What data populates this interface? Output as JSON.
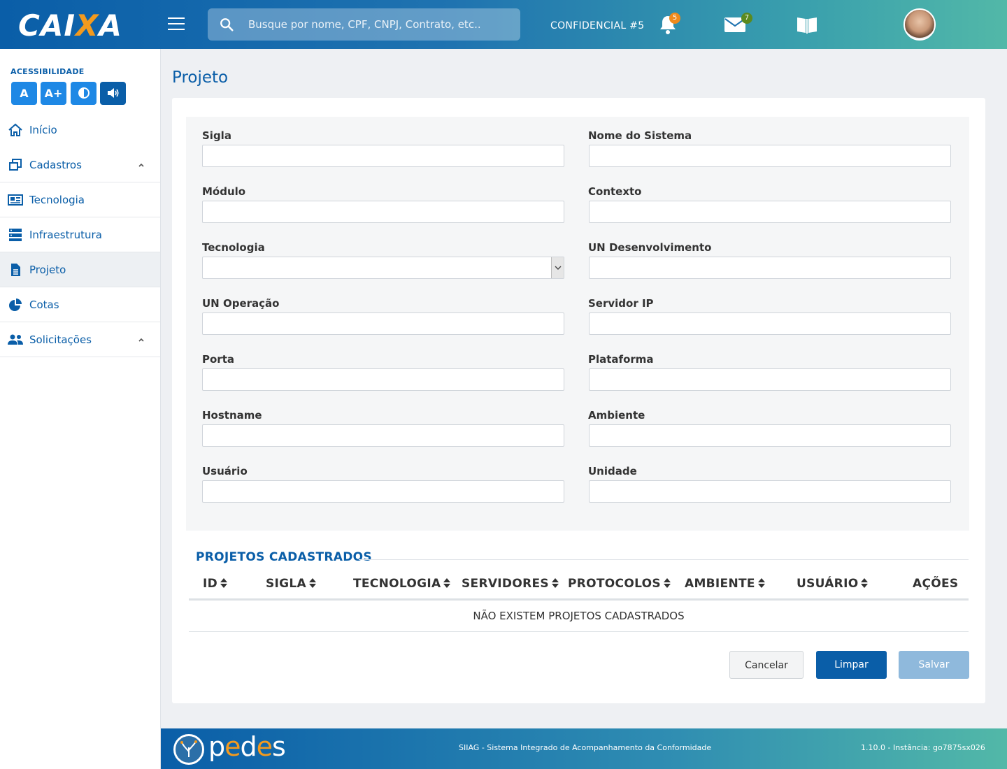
{
  "header": {
    "logo_text_a": "CAI",
    "logo_text_x": "X",
    "logo_text_b": "A",
    "search_placeholder": "Busque por nome, CPF, CNPJ, Contrato, etc..",
    "confidential": "CONFIDENCIAL #5",
    "notifications_count": "5",
    "messages_count": "7",
    "notification_badge_color": "#f08a1c",
    "message_badge_color": "#5a8a1e"
  },
  "sidebar": {
    "accessibility_title": "ACESSIBILIDADE",
    "acc_buttons": [
      "A",
      "A+"
    ],
    "items": [
      {
        "label": "Início"
      },
      {
        "label": "Cadastros"
      },
      {
        "label": "Tecnologia"
      },
      {
        "label": "Infraestrutura"
      },
      {
        "label": "Projeto"
      },
      {
        "label": "Cotas"
      },
      {
        "label": "Solicitações"
      }
    ]
  },
  "main": {
    "title": "Projeto",
    "fields": {
      "sigla": {
        "label": "Sigla",
        "value": ""
      },
      "nome_sistema": {
        "label": "Nome do Sistema",
        "value": ""
      },
      "modulo": {
        "label": "Módulo",
        "value": ""
      },
      "contexto": {
        "label": "Contexto",
        "value": ""
      },
      "tecnologia": {
        "label": "Tecnologia",
        "value": ""
      },
      "un_desenvolvimento": {
        "label": "UN Desenvolvimento",
        "value": ""
      },
      "un_operacao": {
        "label": "UN Operação",
        "value": ""
      },
      "servidor_ip": {
        "label": "Servidor IP",
        "value": ""
      },
      "porta": {
        "label": "Porta",
        "value": ""
      },
      "plataforma": {
        "label": "Plataforma",
        "value": ""
      },
      "hostname": {
        "label": "Hostname",
        "value": ""
      },
      "ambiente": {
        "label": "Ambiente",
        "value": ""
      },
      "usuario": {
        "label": "Usuário",
        "value": ""
      },
      "unidade": {
        "label": "Unidade",
        "value": ""
      }
    },
    "table": {
      "title": "PROJETOS CADASTRADOS",
      "columns": [
        "ID",
        "SIGLA",
        "TECNOLOGIA",
        "SERVIDORES",
        "PROTOCOLOS",
        "AMBIENTE",
        "USUÁRIO",
        "AÇÕES"
      ],
      "empty_message": "NÃO EXISTEM PROJETOS CADASTRADOS"
    },
    "buttons": {
      "cancel": "Cancelar",
      "clear": "Limpar",
      "save": "Salvar"
    }
  },
  "footer": {
    "brand_a": "p",
    "brand_e": "e",
    "brand_b": "d",
    "brand_e2": "e",
    "brand_c": "s",
    "system_name": "SIIAG  - Sistema Integrado de Acompanhamento da Conformidade",
    "version": "1.10.0 - Instância: go7875sx026"
  }
}
